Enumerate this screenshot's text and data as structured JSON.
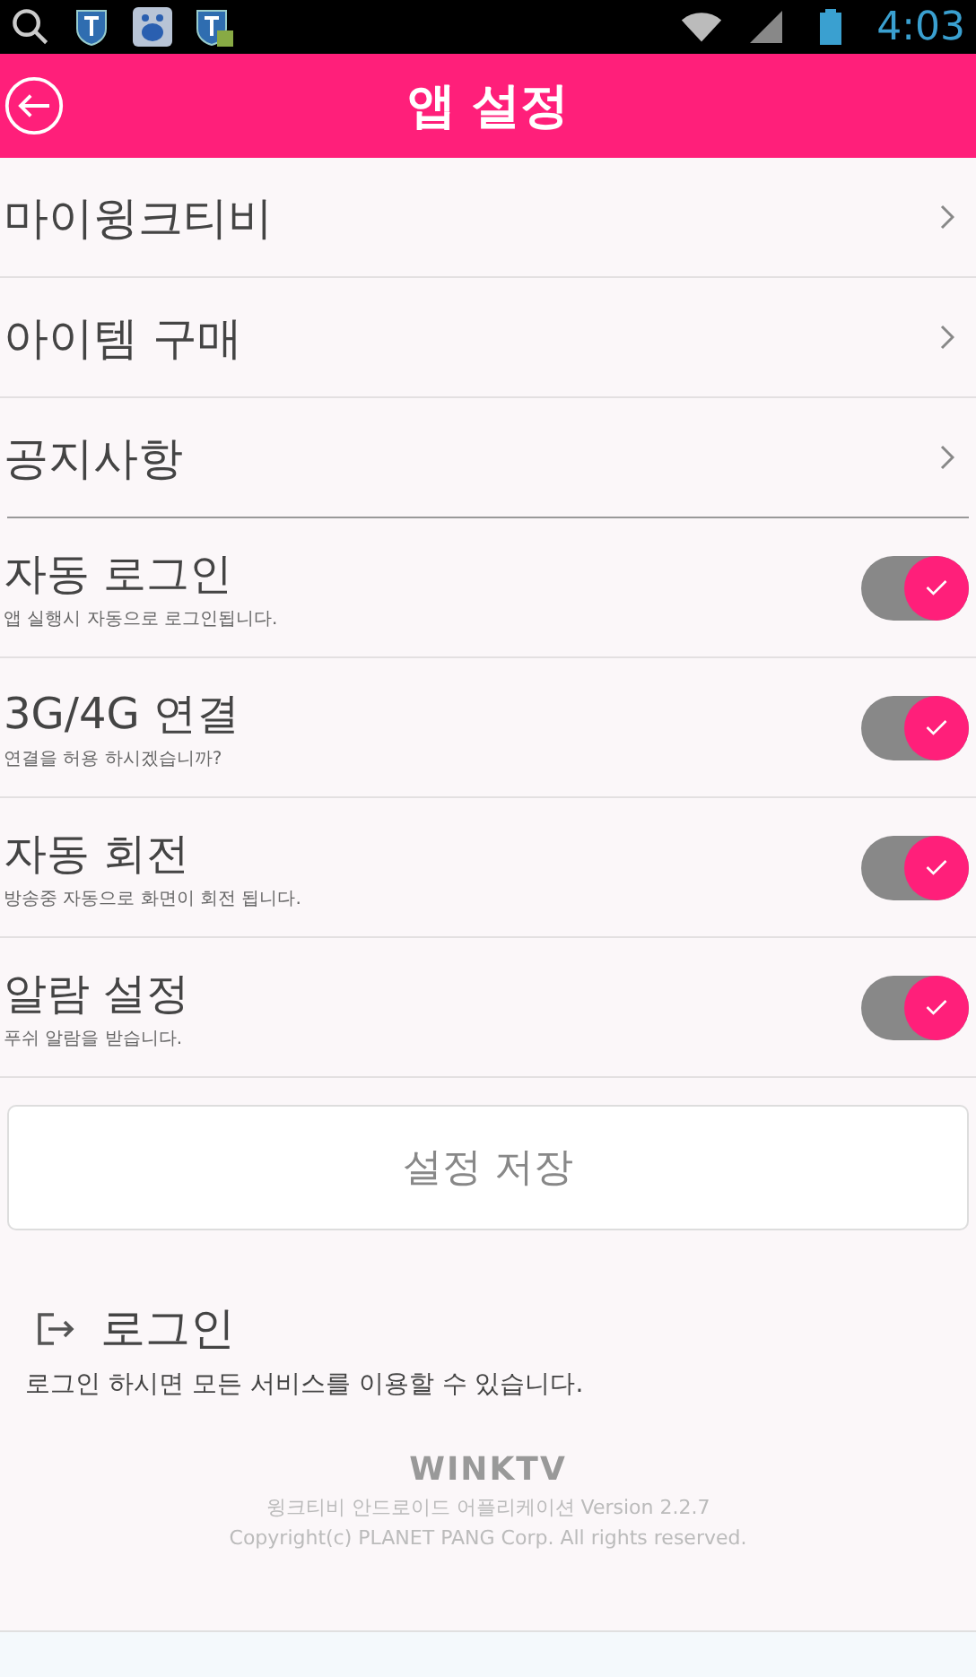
{
  "status_bar": {
    "time": "4:03"
  },
  "header": {
    "title": "앱 설정"
  },
  "menu_items": [
    {
      "label": "마이윙크티비"
    },
    {
      "label": "아이템 구매"
    },
    {
      "label": "공지사항"
    }
  ],
  "settings": [
    {
      "title": "자동 로그인",
      "description": "앱 실행시 자동으로 로그인됩니다.",
      "on": true
    },
    {
      "title": "3G/4G 연결",
      "description": "연결을 허용 하시겠습니까?",
      "on": true
    },
    {
      "title": "자동 회전",
      "description": "방송중 자동으로 화면이 회전 됩니다.",
      "on": true
    },
    {
      "title": "알람 설정",
      "description": "푸쉬 알람을 받습니다.",
      "on": true
    }
  ],
  "save_button": "설정 저장",
  "login": {
    "title": "로그인",
    "description": "로그인 하시면 모든 서비스를 이용할 수 있습니다."
  },
  "footer": {
    "logo": "WINKTV",
    "version": "윙크티비 안드로이드 어플리케이션 Version 2.2.7",
    "copyright": "Copyright(c) PLANET PANG Corp. All rights reserved."
  }
}
